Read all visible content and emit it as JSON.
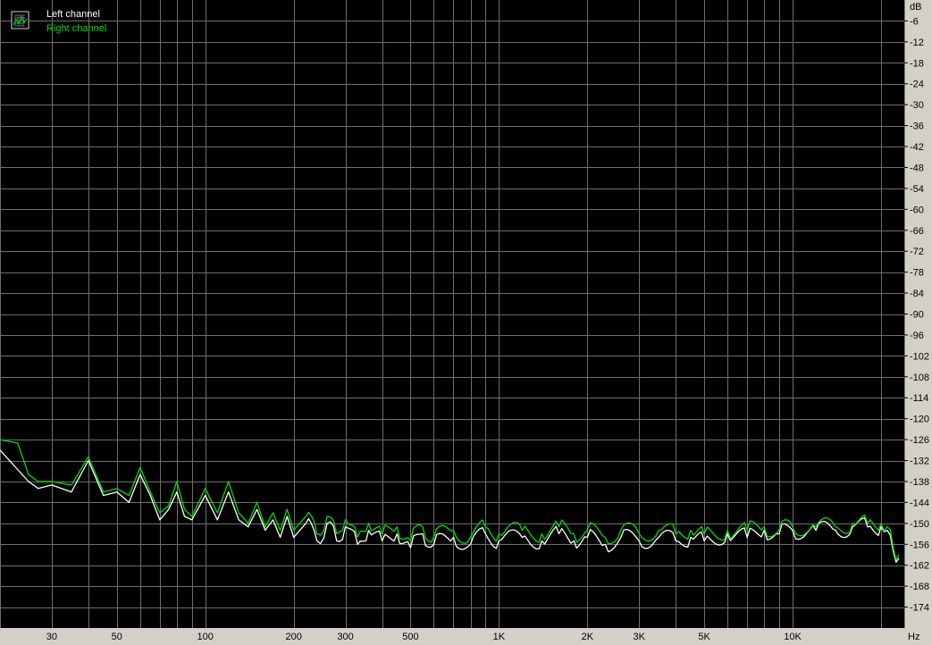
{
  "chart_data": {
    "type": "line",
    "x_scale": "log",
    "xlim": [
      20,
      24000
    ],
    "ylim": [
      -180,
      0
    ],
    "grid": true,
    "y_unit": "dB",
    "x_unit": "Hz",
    "y_ticks": [
      -6,
      -12,
      -18,
      -24,
      -30,
      -36,
      -42,
      -48,
      -54,
      -60,
      -66,
      -72,
      -78,
      -84,
      -90,
      -96,
      -102,
      -108,
      -114,
      -120,
      -126,
      -132,
      -138,
      -144,
      -150,
      -156,
      -162,
      -168,
      -174
    ],
    "x_ticks": [
      {
        "value": 30,
        "label": "30"
      },
      {
        "value": 50,
        "label": "50"
      },
      {
        "value": 100,
        "label": "100"
      },
      {
        "value": 200,
        "label": "200"
      },
      {
        "value": 300,
        "label": "300"
      },
      {
        "value": 500,
        "label": "500"
      },
      {
        "value": 1000,
        "label": "1K"
      },
      {
        "value": 2000,
        "label": "2K"
      },
      {
        "value": 3000,
        "label": "3K"
      },
      {
        "value": 5000,
        "label": "5K"
      },
      {
        "value": 10000,
        "label": "10K"
      }
    ],
    "legend_position": "top-left",
    "background": "#000000",
    "grid_color": "#6e6e6e",
    "series": [
      {
        "name": "Left channel",
        "color": "#ffffff",
        "points": [
          [
            20,
            -129
          ],
          [
            25,
            -138
          ],
          [
            27,
            -140
          ],
          [
            30,
            -139
          ],
          [
            35,
            -141
          ],
          [
            40,
            -132
          ],
          [
            45,
            -142
          ],
          [
            50,
            -141
          ],
          [
            55,
            -144
          ],
          [
            60,
            -136
          ],
          [
            65,
            -142
          ],
          [
            70,
            -149
          ],
          [
            75,
            -146
          ],
          [
            80,
            -141
          ],
          [
            85,
            -148
          ],
          [
            90,
            -149
          ],
          [
            100,
            -142
          ],
          [
            110,
            -149
          ],
          [
            120,
            -141
          ],
          [
            130,
            -149
          ],
          [
            140,
            -151
          ],
          [
            150,
            -146
          ],
          [
            160,
            -152
          ],
          [
            170,
            -149
          ],
          [
            180,
            -154
          ],
          [
            190,
            -148
          ],
          [
            200,
            -154
          ],
          [
            220,
            -150
          ],
          [
            240,
            -155
          ],
          [
            260,
            -150
          ],
          [
            280,
            -155
          ],
          [
            300,
            -151
          ],
          [
            330,
            -156
          ],
          [
            360,
            -152
          ],
          [
            400,
            -155
          ],
          [
            450,
            -153
          ],
          [
            500,
            -157
          ],
          [
            550,
            -153
          ],
          [
            600,
            -156
          ],
          [
            700,
            -154
          ],
          [
            800,
            -156
          ],
          [
            900,
            -153
          ],
          [
            1000,
            -155
          ],
          [
            1200,
            -154
          ],
          [
            1400,
            -155
          ],
          [
            1600,
            -153
          ],
          [
            1800,
            -155
          ],
          [
            2000,
            -154
          ],
          [
            2300,
            -156
          ],
          [
            2600,
            -154
          ],
          [
            3000,
            -155
          ],
          [
            3500,
            -154
          ],
          [
            4000,
            -155
          ],
          [
            4500,
            -154
          ],
          [
            5000,
            -155
          ],
          [
            6000,
            -153
          ],
          [
            7000,
            -154
          ],
          [
            8000,
            -152
          ],
          [
            9000,
            -153
          ],
          [
            10000,
            -152
          ],
          [
            12000,
            -152
          ],
          [
            14000,
            -152
          ],
          [
            16000,
            -151
          ],
          [
            18000,
            -151
          ],
          [
            20000,
            -151
          ],
          [
            21000,
            -152
          ],
          [
            22000,
            -158
          ],
          [
            23000,
            -160
          ]
        ]
      },
      {
        "name": "Right channel",
        "color": "#00dd00",
        "points": [
          [
            20,
            -126
          ],
          [
            23,
            -127
          ],
          [
            25,
            -136
          ],
          [
            27,
            -138
          ],
          [
            30,
            -138
          ],
          [
            35,
            -139
          ],
          [
            40,
            -131
          ],
          [
            45,
            -141
          ],
          [
            50,
            -140
          ],
          [
            55,
            -142
          ],
          [
            60,
            -134
          ],
          [
            65,
            -141
          ],
          [
            70,
            -147
          ],
          [
            75,
            -145
          ],
          [
            80,
            -138
          ],
          [
            85,
            -146
          ],
          [
            90,
            -148
          ],
          [
            100,
            -140
          ],
          [
            110,
            -147
          ],
          [
            120,
            -138
          ],
          [
            130,
            -147
          ],
          [
            140,
            -150
          ],
          [
            150,
            -144
          ],
          [
            160,
            -151
          ],
          [
            170,
            -147
          ],
          [
            180,
            -152
          ],
          [
            190,
            -146
          ],
          [
            200,
            -152
          ],
          [
            220,
            -148
          ],
          [
            240,
            -153
          ],
          [
            260,
            -148
          ],
          [
            280,
            -153
          ],
          [
            300,
            -149
          ],
          [
            330,
            -154
          ],
          [
            360,
            -150
          ],
          [
            400,
            -153
          ],
          [
            450,
            -151
          ],
          [
            500,
            -155
          ],
          [
            550,
            -151
          ],
          [
            600,
            -154
          ],
          [
            700,
            -152
          ],
          [
            800,
            -154
          ],
          [
            900,
            -151
          ],
          [
            1000,
            -153
          ],
          [
            1200,
            -152
          ],
          [
            1400,
            -153
          ],
          [
            1600,
            -151
          ],
          [
            1800,
            -153
          ],
          [
            2000,
            -152
          ],
          [
            2300,
            -154
          ],
          [
            2600,
            -152
          ],
          [
            3000,
            -153
          ],
          [
            3500,
            -152
          ],
          [
            4000,
            -153
          ],
          [
            4500,
            -152
          ],
          [
            5000,
            -153
          ],
          [
            6000,
            -152
          ],
          [
            7000,
            -152
          ],
          [
            8000,
            -151
          ],
          [
            9000,
            -152
          ],
          [
            10000,
            -151
          ],
          [
            12000,
            -151
          ],
          [
            14000,
            -151
          ],
          [
            16000,
            -150
          ],
          [
            18000,
            -150
          ],
          [
            20000,
            -150
          ],
          [
            21000,
            -151
          ],
          [
            22000,
            -157
          ],
          [
            23000,
            -159
          ]
        ]
      }
    ]
  }
}
